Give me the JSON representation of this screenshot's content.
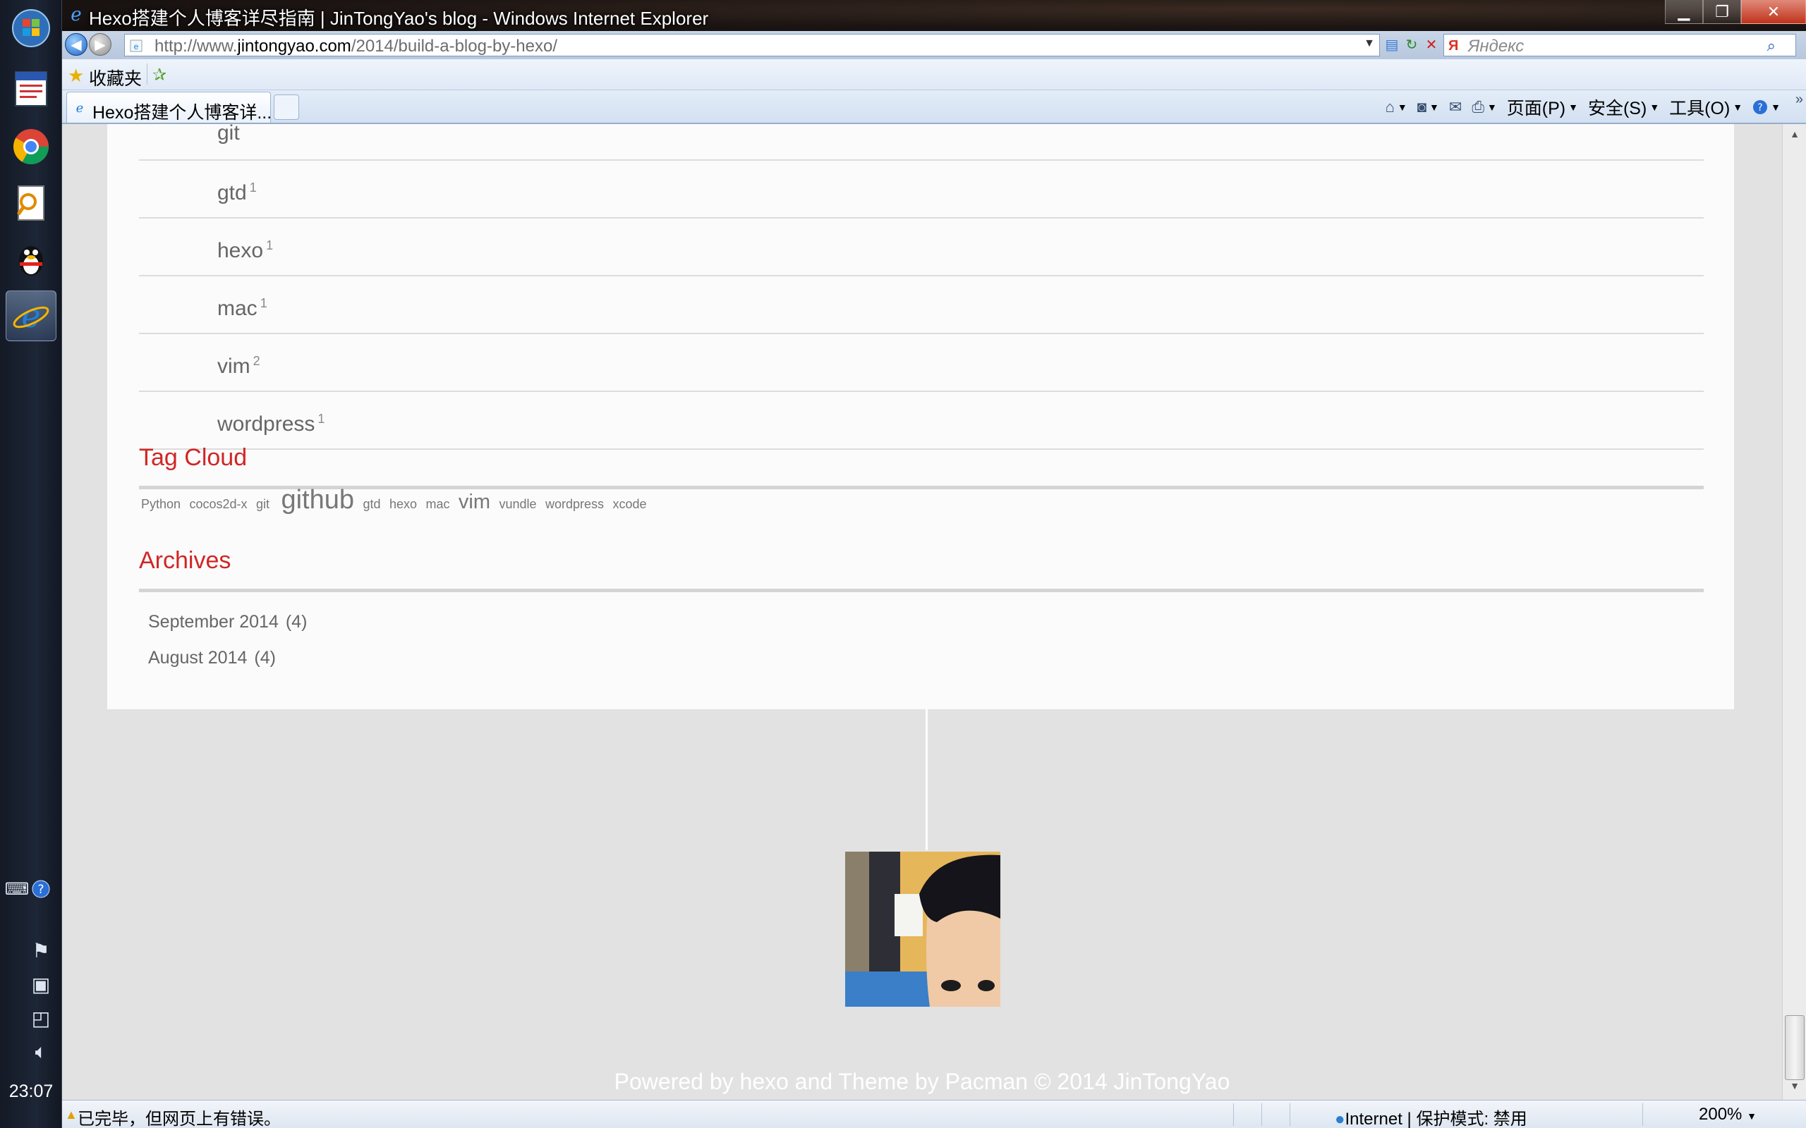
{
  "window": {
    "title": "Hexo搭建个人博客详尽指南 | JinTongYao's blog - Windows Internet Explorer",
    "url_prefix": "http://www.",
    "url_domain": "jintongyao.com",
    "url_path": "/2014/build-a-blog-by-hexo/",
    "search_placeholder": "Яндекс",
    "favorites_label": "收藏夹",
    "tab_label": "Hexo搭建个人博客详...",
    "commands": {
      "page": "页面(P)",
      "safety": "安全(S)",
      "tools": "工具(O)"
    }
  },
  "taskbar": {
    "clock": "23:07"
  },
  "tags": {
    "partial_top": "git",
    "items": [
      {
        "name": "gtd",
        "count": "1"
      },
      {
        "name": "hexo",
        "count": "1"
      },
      {
        "name": "mac",
        "count": "1"
      },
      {
        "name": "vim",
        "count": "2"
      },
      {
        "name": "wordpress",
        "count": "1"
      }
    ]
  },
  "tag_cloud": {
    "title": "Tag Cloud",
    "items": [
      {
        "label": "Python",
        "weight": "small"
      },
      {
        "label": "cocos2d-x",
        "weight": "small"
      },
      {
        "label": "git",
        "weight": "small"
      },
      {
        "label": "github",
        "weight": "large"
      },
      {
        "label": "gtd",
        "weight": "small"
      },
      {
        "label": "hexo",
        "weight": "small"
      },
      {
        "label": "mac",
        "weight": "small"
      },
      {
        "label": "vim",
        "weight": "medium"
      },
      {
        "label": "vundle",
        "weight": "small"
      },
      {
        "label": "wordpress",
        "weight": "small"
      },
      {
        "label": "xcode",
        "weight": "small"
      }
    ]
  },
  "archives": {
    "title": "Archives",
    "items": [
      {
        "label": "September 2014",
        "count": "(4)"
      },
      {
        "label": "August 2014",
        "count": "(4)"
      }
    ]
  },
  "footer": {
    "text": "Powered by hexo and Theme by Pacman © 2014 JinTongYao"
  },
  "status": {
    "message": "已完毕，但网页上有错误。",
    "zone": "Internet | 保护模式: 禁用",
    "zoom": "200%"
  },
  "colors": {
    "accent_red": "#d02626",
    "page_bg": "#e2e2e2",
    "card_bg": "#fbfbfb"
  }
}
